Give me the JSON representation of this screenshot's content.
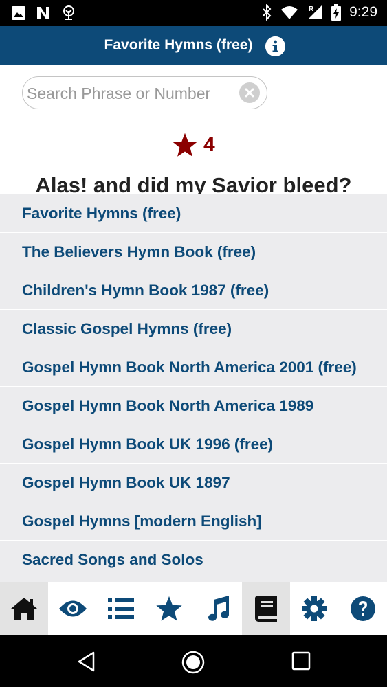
{
  "status_bar": {
    "time": "9:29",
    "icons": [
      "image-icon",
      "n-app-icon",
      "tree-app-icon",
      "bluetooth-icon",
      "wifi-icon",
      "signal-roaming-icon",
      "battery-charging-icon"
    ]
  },
  "header": {
    "title": "Favorite Hymns (free)",
    "info_icon": "info-circle-icon"
  },
  "search": {
    "placeholder": "Search Phrase or Number",
    "value": ""
  },
  "rating": {
    "icon": "star-icon",
    "count": "4",
    "color": "#8b0000"
  },
  "hymn": {
    "title": "Alas! and did my Savior bleed?"
  },
  "book_list": {
    "items": [
      "Favorite Hymns (free)",
      "The Believers Hymn Book (free)",
      "Children's Hymn Book 1987 (free)",
      "Classic Gospel Hymns (free)",
      "Gospel Hymn Book North America 2001 (free)",
      "Gospel Hymn Book North America 1989",
      "Gospel Hymn Book UK 1996 (free)",
      "Gospel Hymn Book UK 1897",
      "Gospel Hymns [modern English]",
      "Sacred Songs and Solos"
    ]
  },
  "tab_bar": {
    "tabs": [
      {
        "icon": "home-icon",
        "active": true
      },
      {
        "icon": "eye-icon",
        "active": false
      },
      {
        "icon": "list-icon",
        "active": false
      },
      {
        "icon": "star-icon",
        "active": false
      },
      {
        "icon": "music-note-icon",
        "active": false
      },
      {
        "icon": "book-icon",
        "active": true
      },
      {
        "icon": "gear-icon",
        "active": false
      },
      {
        "icon": "question-circle-icon",
        "active": false
      }
    ]
  },
  "nav_bar": {
    "icons": [
      "back-icon",
      "home-circle-icon",
      "recents-square-icon"
    ]
  },
  "colors": {
    "brand": "#0d4a78",
    "list_background": "#ececee",
    "rating": "#8b0000"
  }
}
